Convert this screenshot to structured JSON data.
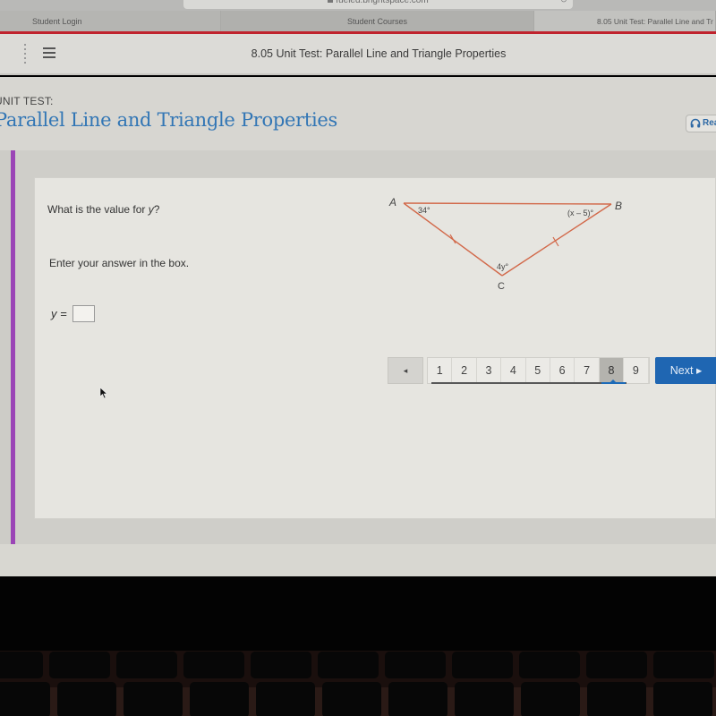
{
  "browser": {
    "url": "fueled.brightspace.com",
    "tabs": [
      {
        "label": "Student Login"
      },
      {
        "label": "Student Courses"
      },
      {
        "label": "8.05 Unit Test: Parallel Line and Tr"
      }
    ]
  },
  "header": {
    "title": "8.05 Unit Test: Parallel Line and Triangle Properties",
    "menu_icon": "hamburger-icon"
  },
  "page": {
    "unit_label": "UNIT TEST:",
    "unit_title": "Parallel Line and Triangle Properties",
    "read_button": "Read"
  },
  "question": {
    "prompt_prefix": "What is the value for ",
    "prompt_var": "y",
    "prompt_suffix": "?",
    "instruction": "Enter your answer in the box.",
    "answer_label": "y =",
    "answer_value": ""
  },
  "figure": {
    "vertices": {
      "a": "A",
      "b": "B",
      "c": "C"
    },
    "angles": {
      "a": "34°",
      "b": "(x – 5)°",
      "c": "4y°"
    },
    "line_color": "#d2694a"
  },
  "pagination": {
    "prev_icon": "◂",
    "pages": [
      "1",
      "2",
      "3",
      "4",
      "5",
      "6",
      "7",
      "8",
      "9"
    ],
    "current_page": "8",
    "next_label": "Next ▸"
  },
  "colors": {
    "accent_blue": "#1f66b2",
    "title_blue": "#3276b5",
    "purple_bar": "#9b45b6",
    "browser_red": "#c0232d"
  }
}
